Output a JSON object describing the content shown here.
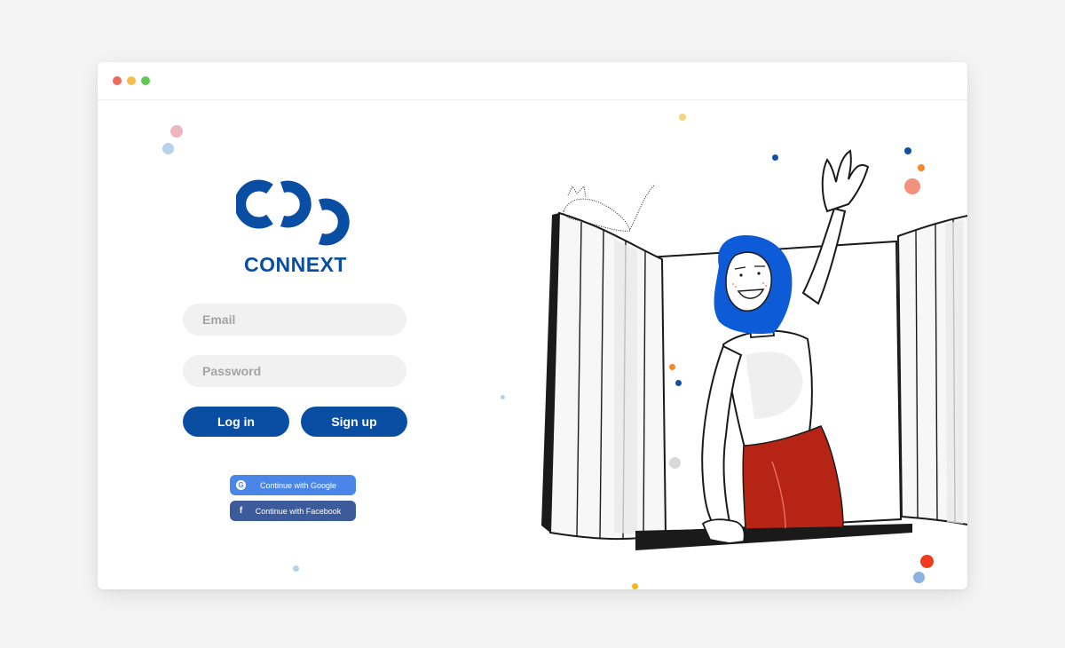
{
  "brand": {
    "name": "CONNEXT",
    "color": "#0a4ea3"
  },
  "form": {
    "email_placeholder": "Email",
    "password_placeholder": "Password",
    "login_label": "Log in",
    "signup_label": "Sign up"
  },
  "social": {
    "google_label": "Continue with Google",
    "facebook_label": "Continue with Facebook",
    "google_icon": "google-icon",
    "facebook_icon": "facebook-icon"
  },
  "colors": {
    "primary": "#0a4ea3",
    "google": "#4a86e8",
    "facebook": "#3b5b9a",
    "skirt": "#b52415",
    "hair": "#0d5bd6"
  }
}
